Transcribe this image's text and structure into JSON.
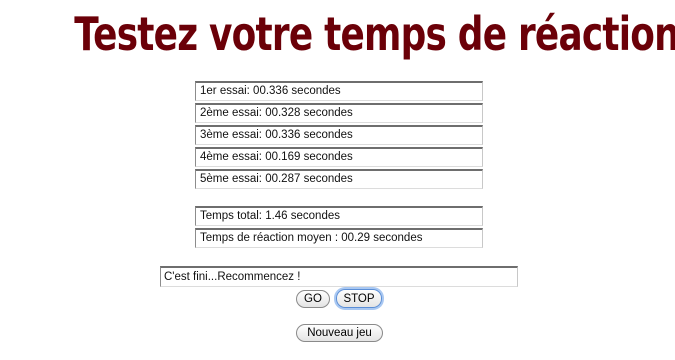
{
  "page": {
    "title": "Testez votre temps de réaction"
  },
  "trials": [
    " 1er essai: 00.336 secondes",
    "2ème essai: 00.328 secondes",
    "3ème essai: 00.336 secondes",
    "4ème essai: 00.169 secondes",
    "5ème essai: 00.287 secondes"
  ],
  "summary": {
    "total": "Temps total: 1.46 secondes",
    "average": "Temps de réaction moyen : 00.29 secondes"
  },
  "status": {
    "value": "C'est fini...Recommencez !"
  },
  "buttons": {
    "go": "GO",
    "stop": "STOP",
    "new_game": "Nouveau jeu"
  }
}
